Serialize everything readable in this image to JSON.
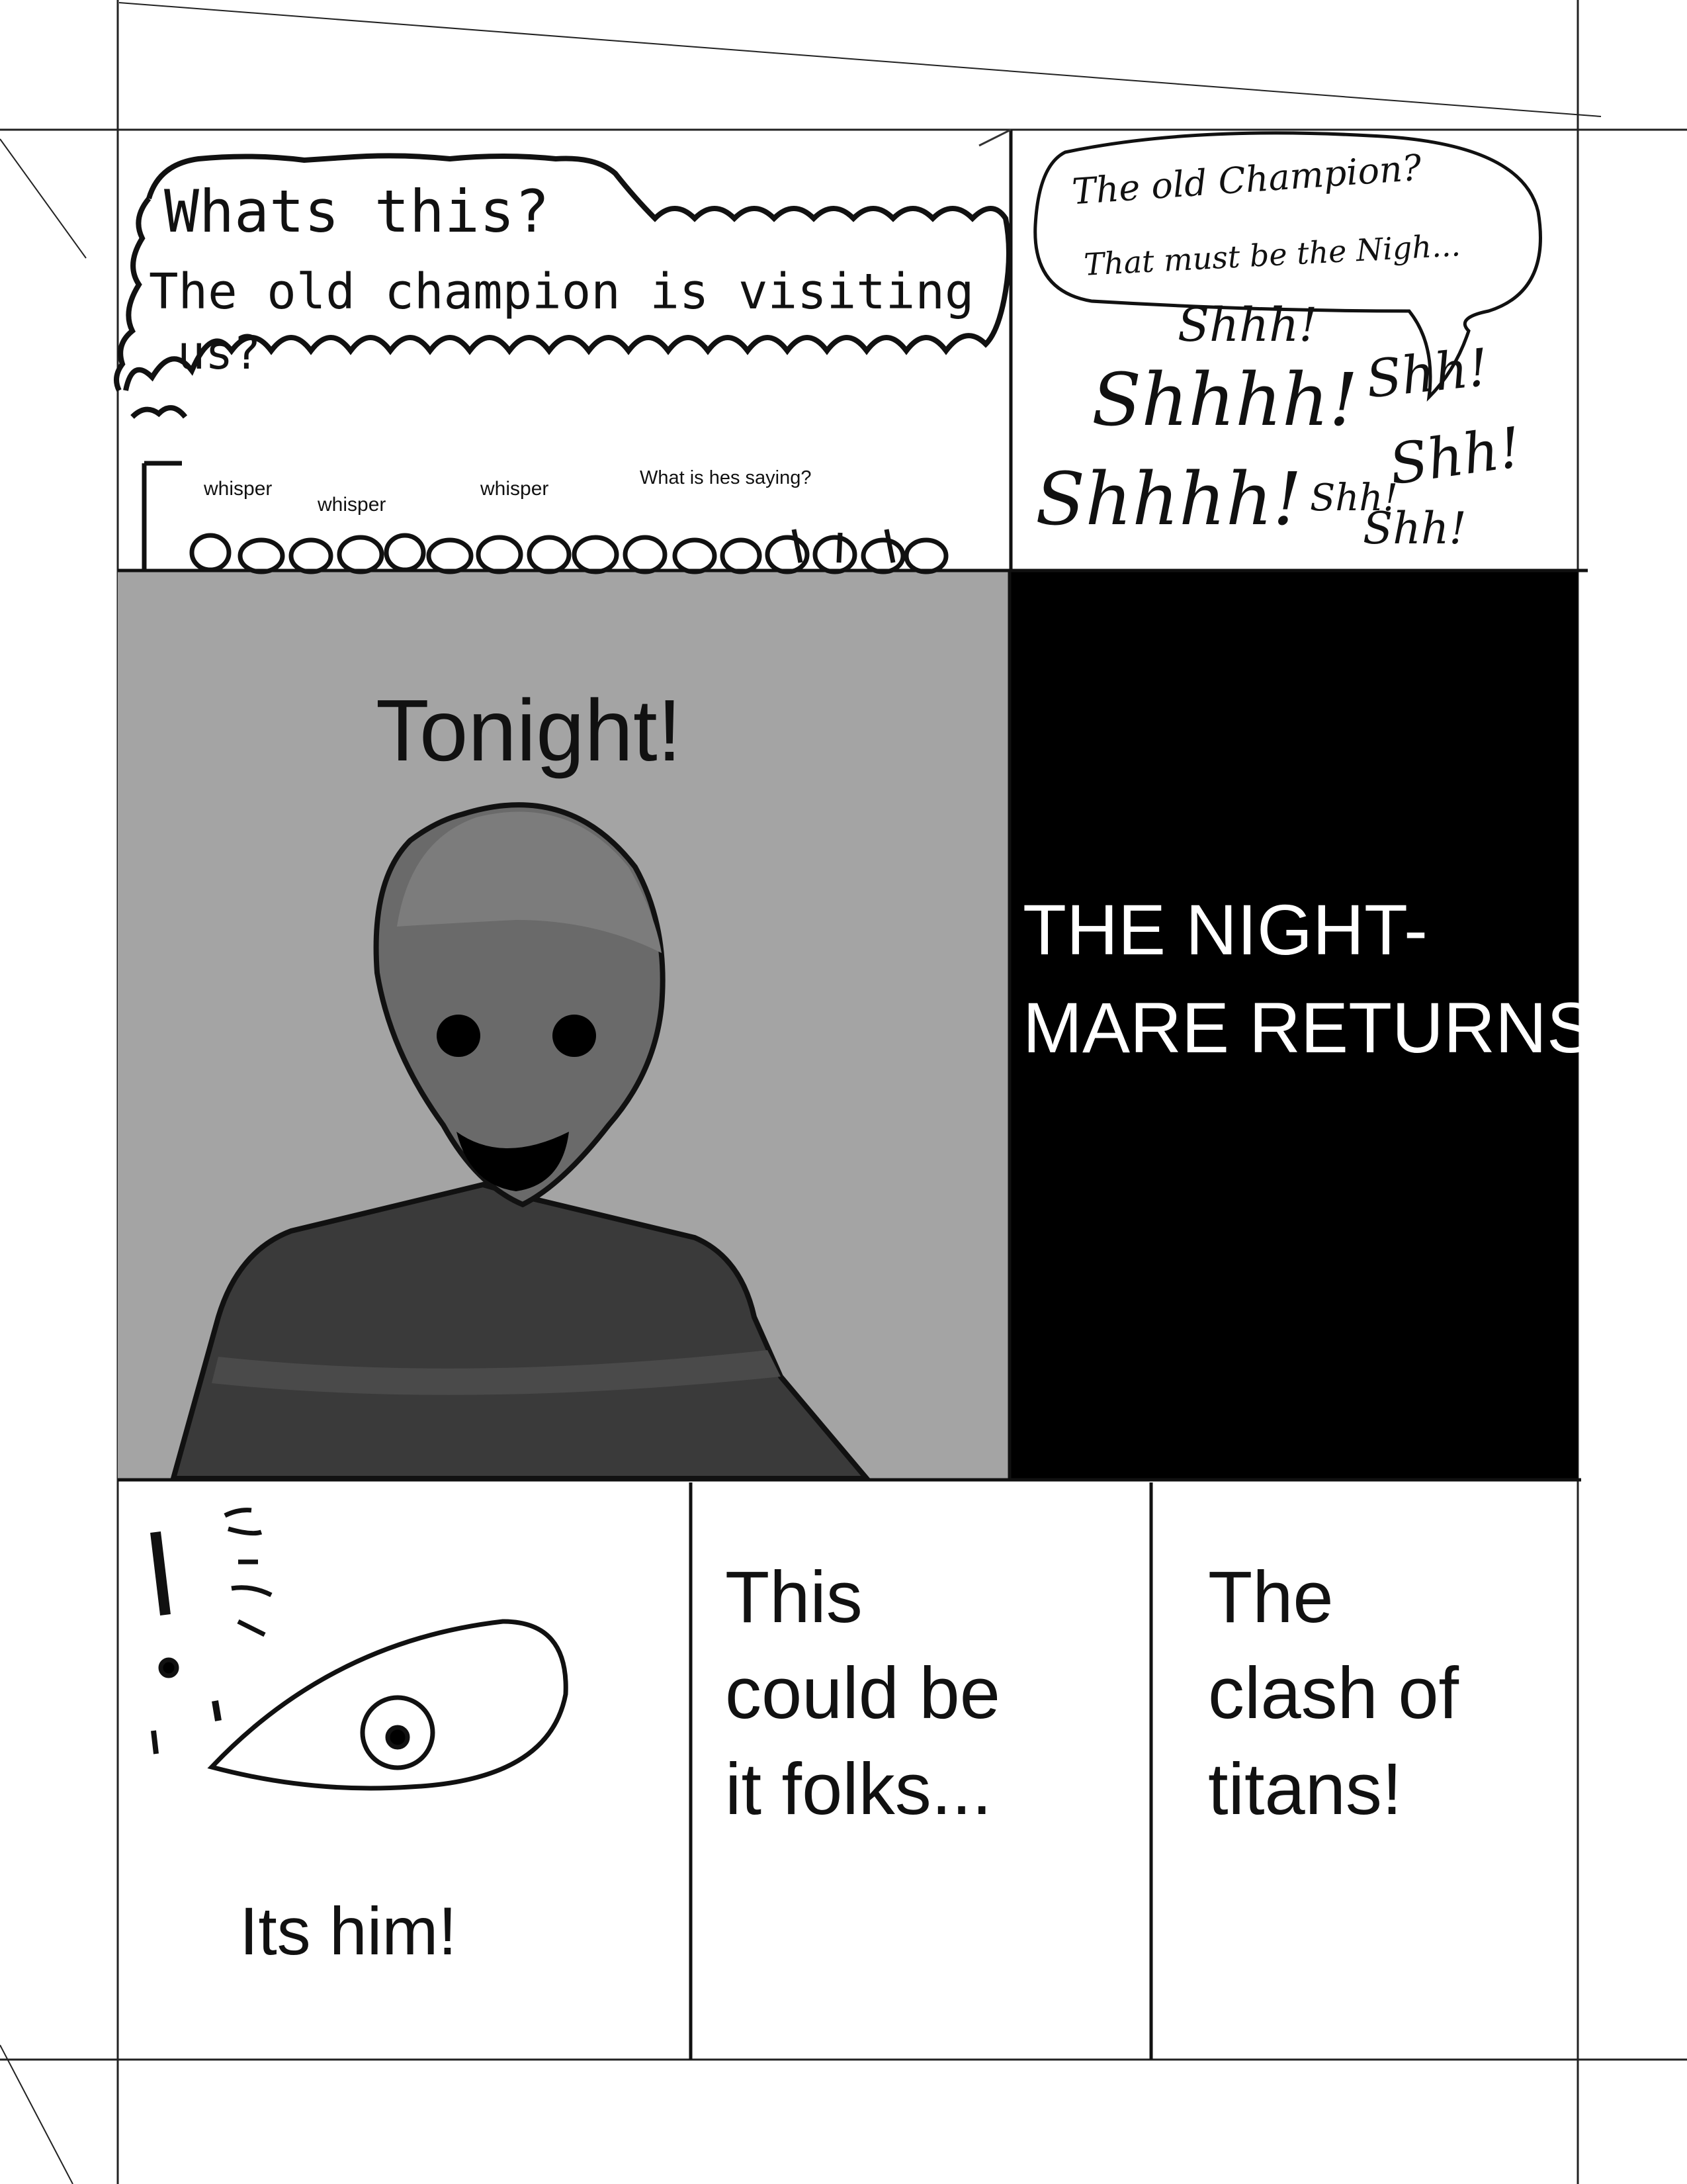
{
  "colors": {
    "ink": "#111111",
    "panel_gray": "#a4a4a4",
    "figure_head": "#6a6a6a",
    "figure_body": "#3a3a3a",
    "black_panel": "#000000",
    "title_text": "#ffffff"
  },
  "panel1": {
    "bubble_line1": "Whats this?",
    "bubble_line2": "The old champion is visiting",
    "bubble_line3": "us?",
    "crowd": {
      "whisper_1": "whisper",
      "whisper_2": "whisper",
      "whisper_3": "whisper",
      "question": "What is hes saying?"
    }
  },
  "panel2": {
    "bubble_line1": "The old Champion?",
    "bubble_line2": "That must be the Nigh...",
    "shushes": [
      "Shhh!",
      "Shhhh!",
      "Shhhh!",
      "Shh!",
      "Shh!",
      "Shh!",
      "Shh!"
    ]
  },
  "panel3": {
    "caption": "Tonight!"
  },
  "panel4": {
    "title_line1": "THE NIGHT-",
    "title_line2": "MARE RETURNS"
  },
  "panel5": {
    "caption": "Its him!"
  },
  "panel6": {
    "line1": "This",
    "line2": "could be",
    "line3": "it folks..."
  },
  "panel7": {
    "line1": "The",
    "line2": "clash of",
    "line3": "titans!"
  }
}
